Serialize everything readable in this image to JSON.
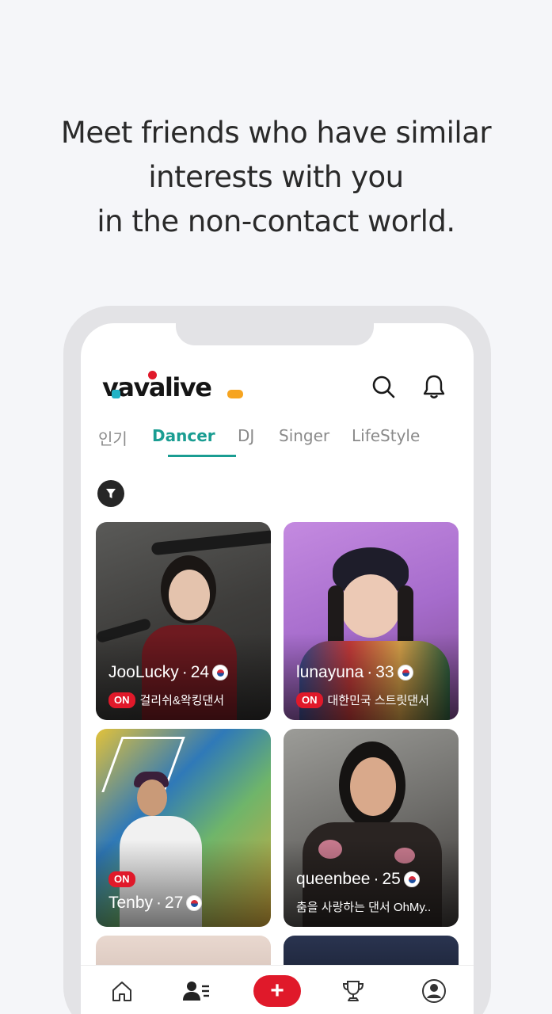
{
  "headline": {
    "line1": "Meet friends who have similar",
    "line2": "interests with you",
    "line3": "in the non-contact world."
  },
  "app": {
    "logo_text": "vavalive",
    "colors": {
      "accent": "#1a9d92",
      "live_red": "#e0192a",
      "logo_teal": "#22b2c5",
      "logo_orange": "#f6a420"
    }
  },
  "header_icons": [
    "search-icon",
    "bell-icon"
  ],
  "tabs": [
    {
      "label": "인기",
      "active": false
    },
    {
      "label": "Dancer",
      "active": true
    },
    {
      "label": "DJ",
      "active": false
    },
    {
      "label": "Singer",
      "active": false
    },
    {
      "label": "LifeStyle",
      "active": false
    }
  ],
  "filter_icon": "filter-icon",
  "cards": [
    {
      "name": "JooLucky",
      "age": "24",
      "status": "ON",
      "description": "걸리쉬&왁킹댄서"
    },
    {
      "name": "lunayuna",
      "age": "33",
      "status": "ON",
      "description": "대한민국 스트릿댄서"
    },
    {
      "name": "Tenby",
      "age": "27",
      "status": "ON",
      "description": ""
    },
    {
      "name": "queenbee",
      "age": "25",
      "status": "",
      "description": "춤을 사랑하는 댄서 OhMy.."
    }
  ],
  "bottom_nav": [
    {
      "icon": "home-icon"
    },
    {
      "icon": "people-list-icon"
    },
    {
      "icon": "plus-icon",
      "label": "+"
    },
    {
      "icon": "trophy-icon"
    },
    {
      "icon": "profile-icon"
    }
  ]
}
